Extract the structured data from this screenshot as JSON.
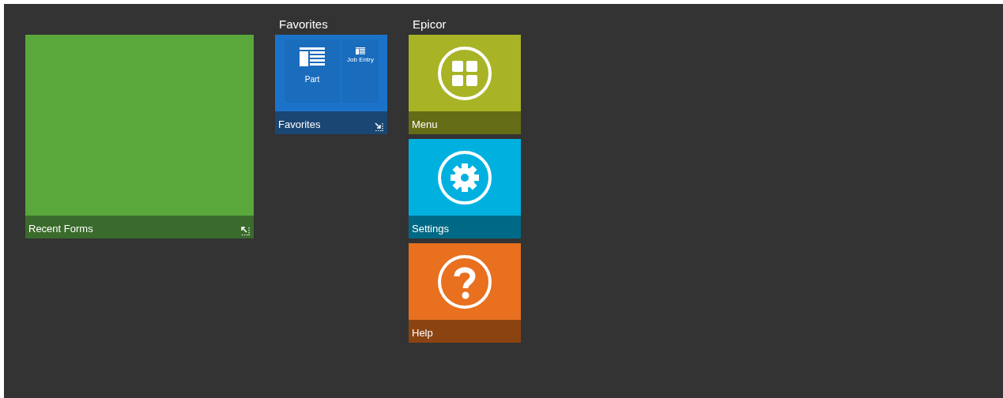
{
  "recent_tile": {
    "label": "Recent Forms",
    "color": "#5aa73c"
  },
  "groups": [
    {
      "title": "Favorites",
      "tiles": [
        {
          "kind": "favorites",
          "label": "Favorites",
          "color": "#1b73c9",
          "items": [
            {
              "label": "Part"
            },
            {
              "label": "Job Entry"
            }
          ]
        }
      ]
    },
    {
      "title": "Epicor",
      "tiles": [
        {
          "kind": "menu",
          "label": "Menu",
          "color": "#a8b425"
        },
        {
          "kind": "settings",
          "label": "Settings",
          "color": "#00b1e0"
        },
        {
          "kind": "help",
          "label": "Help",
          "color": "#e8701f"
        }
      ]
    }
  ]
}
